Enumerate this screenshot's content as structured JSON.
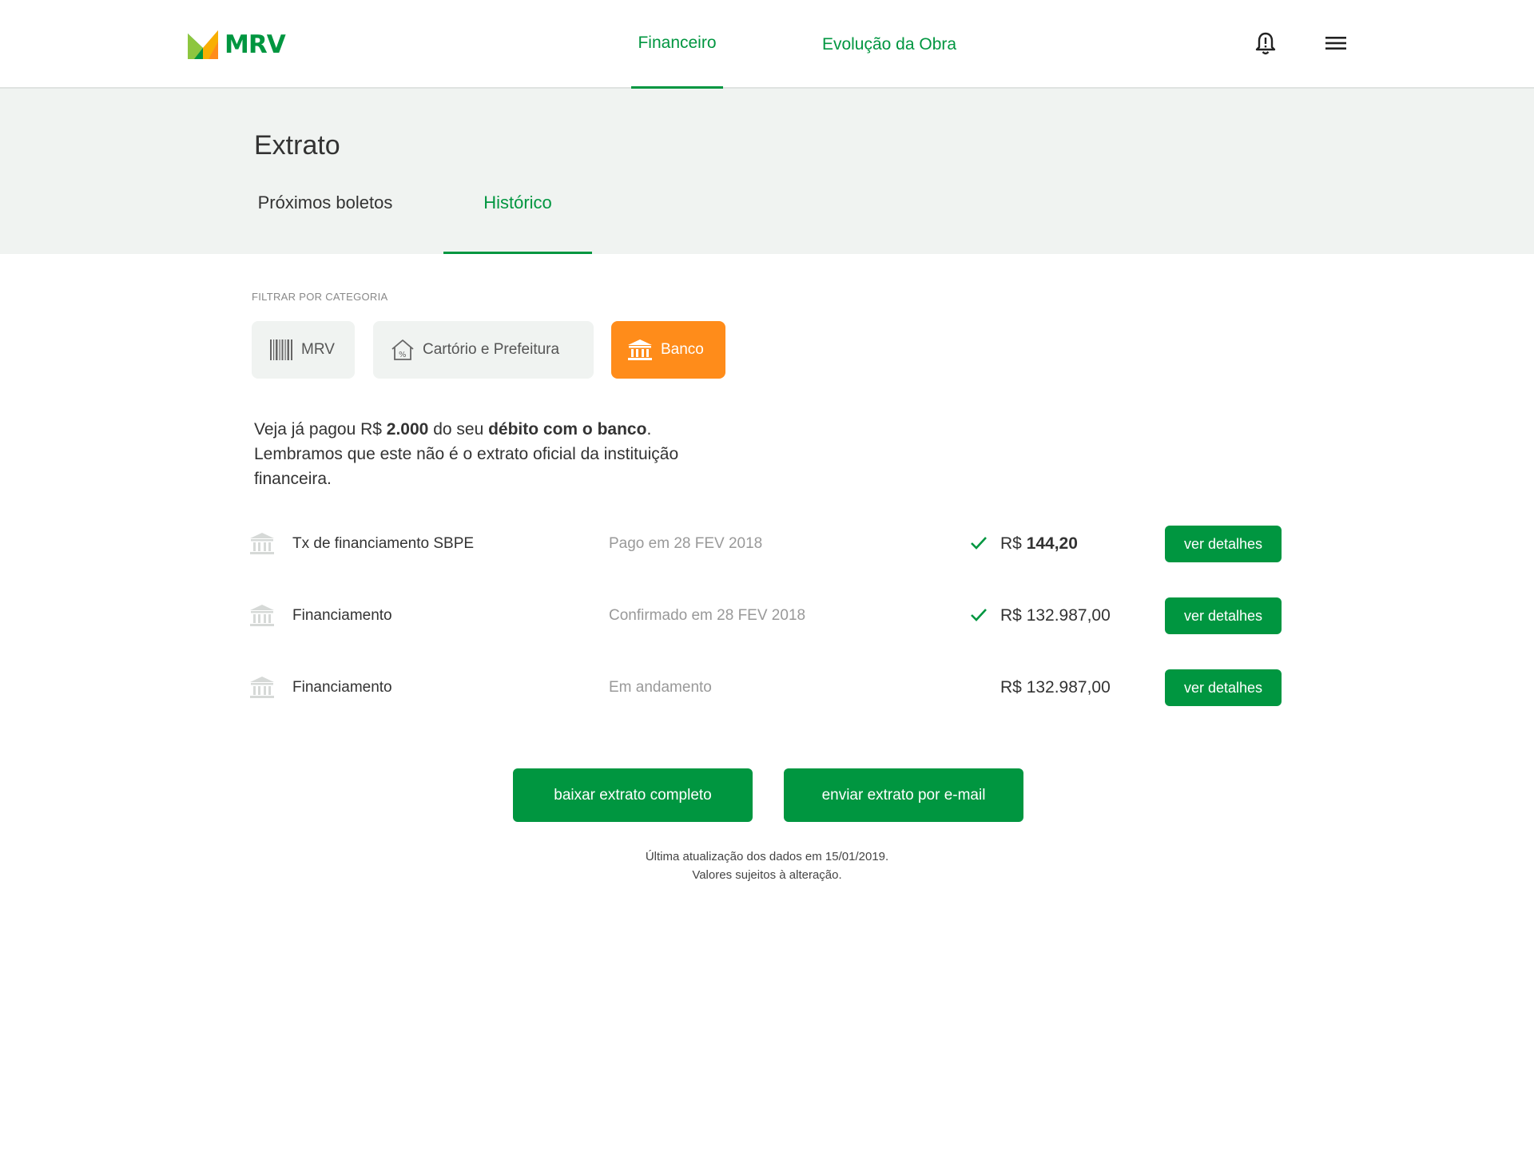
{
  "brand": {
    "name": "MRV",
    "colors": {
      "green": "#009640",
      "orange": "#ff8c1a",
      "light_green": "#8dc63f"
    }
  },
  "nav": {
    "tabs": [
      {
        "label": "Financeiro",
        "active": true
      },
      {
        "label": "Evolução da Obra",
        "active": false
      }
    ],
    "icons": [
      "bell-alert-icon",
      "hamburger-menu-icon"
    ]
  },
  "page": {
    "title": "Extrato",
    "subtabs": [
      {
        "label": "Próximos boletos",
        "active": false
      },
      {
        "label": "Histórico",
        "active": true
      }
    ]
  },
  "filters": {
    "label": "FILTRAR POR CATEGORIA",
    "chips": [
      {
        "label": "MRV",
        "icon": "barcode-icon",
        "active": false
      },
      {
        "label": "Cartório e Prefeitura",
        "icon": "house-percent-icon",
        "active": false
      },
      {
        "label": "Banco",
        "icon": "bank-icon",
        "active": true
      }
    ]
  },
  "info": {
    "part1": "Veja já pagou R$ ",
    "amount": "2.000",
    "part2": " do seu ",
    "bold2": "débito com o banco",
    "part3": ".",
    "line2": "Lembramos que este não é o extrato oficial da instituição financeira."
  },
  "rows": [
    {
      "description": "Tx de financiamento SBPE",
      "status": "Pago em 28 FEV 2018",
      "checked": true,
      "currency": "R$ ",
      "amount": "144,20",
      "amount_bold": true,
      "button": "ver detalhes"
    },
    {
      "description": "Financiamento",
      "status": "Confirmado em 28 FEV 2018",
      "checked": true,
      "currency": "R$ ",
      "amount": "132.987,00",
      "amount_bold": false,
      "button": "ver detalhes"
    },
    {
      "description": "Financiamento",
      "status": "Em andamento",
      "checked": false,
      "currency": "R$ ",
      "amount": "132.987,00",
      "amount_bold": false,
      "button": "ver detalhes"
    }
  ],
  "actions": {
    "download": "baixar extrato completo",
    "email": "enviar extrato por e-mail"
  },
  "footnote": {
    "line1": "Última atualização dos dados em 15/01/2019.",
    "line2": "Valores sujeitos à alteração."
  }
}
